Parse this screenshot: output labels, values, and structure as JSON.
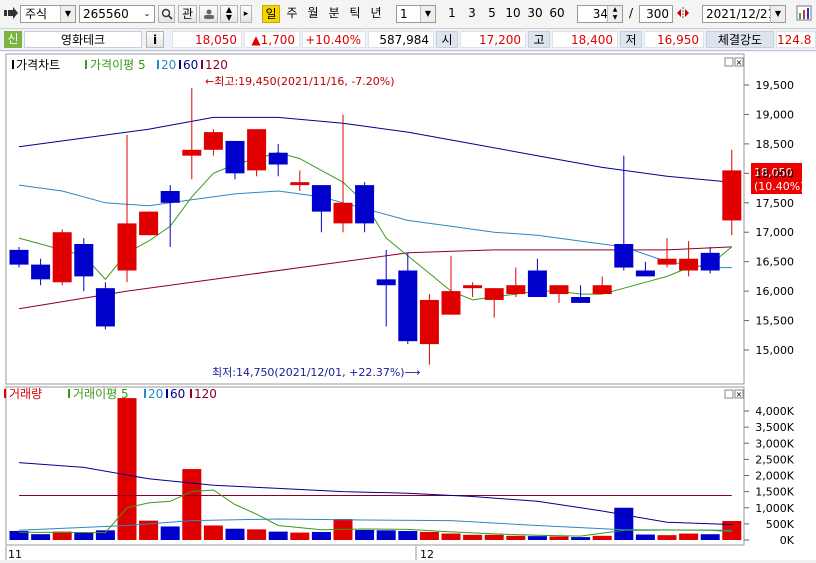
{
  "toolbar": {
    "market": "주식",
    "code": "265560",
    "btn_gwan": "관",
    "period_selected": "일",
    "periods": [
      "주",
      "월",
      "분",
      "틱",
      "년"
    ],
    "interval_value": "1",
    "interval_quick": [
      "1",
      "3",
      "5",
      "10",
      "30",
      "60"
    ],
    "zoom_value": "34",
    "zoom_sep": "/",
    "zoom_total": "300",
    "date": "2021/12/21"
  },
  "info": {
    "badge": "신",
    "name": "영화테크",
    "info_btn": "i",
    "price": "18,050",
    "change": "▲1,700",
    "change_pct": "+10.40%",
    "volume": "587,984",
    "open_label": "시",
    "open": "17,200",
    "high_label": "고",
    "high": "18,400",
    "low_label": "저",
    "low": "16,950",
    "strength_label": "체결강도",
    "strength": "124.8"
  },
  "price_legend": {
    "title": "가격차트",
    "ma_label": "가격이평",
    "ma": [
      "5",
      "20",
      "60",
      "120"
    ]
  },
  "vol_legend": {
    "title": "거래량",
    "ma_label": "거래이평",
    "ma": [
      "5",
      "20",
      "60",
      "120"
    ]
  },
  "annotations": {
    "high": "←최고:19,450(2021/11/16, -7.20%)",
    "low": "최저:14,750(2021/12/01, +22.37%)⟶"
  },
  "current_tag": {
    "price": "18,050",
    "pct": "(10.40%)"
  },
  "x_labels": [
    "11",
    "12"
  ],
  "colors": {
    "up": "#e00000",
    "down": "#0000cc",
    "ma5": "#3a9a1a",
    "ma20": "#2a88c8",
    "ma60": "#00008b",
    "ma120": "#8b0028"
  },
  "chart_data": {
    "type": "candlestick",
    "price_axis": {
      "ticks": [
        "15,000",
        "15,500",
        "16,000",
        "16,500",
        "17,000",
        "17,500",
        "18,000",
        "18,500",
        "19,000",
        "19,500"
      ],
      "range": [
        14600,
        19800
      ]
    },
    "volume_axis": {
      "ticks": [
        "0K",
        "500K",
        "1,000K",
        "1,500K",
        "2,000K",
        "2,500K",
        "3,000K",
        "3,500K",
        "4,000K"
      ],
      "range": [
        0,
        4300
      ]
    },
    "candles": [
      {
        "o": 16700,
        "h": 16750,
        "l": 16400,
        "c": 16450,
        "v": 280
      },
      {
        "o": 16450,
        "h": 16550,
        "l": 16100,
        "c": 16200,
        "v": 180
      },
      {
        "o": 16150,
        "h": 17050,
        "l": 16100,
        "c": 17000,
        "v": 260
      },
      {
        "o": 16800,
        "h": 16900,
        "l": 16000,
        "c": 16250,
        "v": 230
      },
      {
        "o": 16050,
        "h": 16150,
        "l": 15350,
        "c": 15400,
        "v": 300
      },
      {
        "o": 16350,
        "h": 18650,
        "l": 16150,
        "c": 17150,
        "v": 4400
      },
      {
        "o": 16950,
        "h": 17350,
        "l": 16950,
        "c": 17350,
        "v": 600
      },
      {
        "o": 17700,
        "h": 17800,
        "l": 16750,
        "c": 17500,
        "v": 420
      },
      {
        "o": 18300,
        "h": 19450,
        "l": 17900,
        "c": 18400,
        "v": 2200
      },
      {
        "o": 18400,
        "h": 18750,
        "l": 18300,
        "c": 18700,
        "v": 450
      },
      {
        "o": 18550,
        "h": 18550,
        "l": 17900,
        "c": 18000,
        "v": 350
      },
      {
        "o": 18050,
        "h": 18750,
        "l": 17950,
        "c": 18750,
        "v": 330
      },
      {
        "o": 18350,
        "h": 18500,
        "l": 17950,
        "c": 18150,
        "v": 260
      },
      {
        "o": 17800,
        "h": 18050,
        "l": 17700,
        "c": 17850,
        "v": 230
      },
      {
        "o": 17800,
        "h": 17800,
        "l": 17000,
        "c": 17350,
        "v": 250
      },
      {
        "o": 17150,
        "h": 19000,
        "l": 17000,
        "c": 17500,
        "v": 650
      },
      {
        "o": 17800,
        "h": 17850,
        "l": 17000,
        "c": 17150,
        "v": 310
      },
      {
        "o": 16200,
        "h": 16700,
        "l": 15400,
        "c": 16100,
        "v": 300
      },
      {
        "o": 16350,
        "h": 16650,
        "l": 15100,
        "c": 15150,
        "v": 280
      },
      {
        "o": 15100,
        "h": 15950,
        "l": 14750,
        "c": 15850,
        "v": 250
      },
      {
        "o": 15600,
        "h": 16600,
        "l": 15600,
        "c": 16000,
        "v": 200
      },
      {
        "o": 16050,
        "h": 16150,
        "l": 15900,
        "c": 16100,
        "v": 160
      },
      {
        "o": 15850,
        "h": 16050,
        "l": 15550,
        "c": 16050,
        "v": 160
      },
      {
        "o": 15950,
        "h": 16400,
        "l": 15900,
        "c": 16100,
        "v": 130
      },
      {
        "o": 16350,
        "h": 16550,
        "l": 15900,
        "c": 15900,
        "v": 120
      },
      {
        "o": 15950,
        "h": 16100,
        "l": 15800,
        "c": 16100,
        "v": 110
      },
      {
        "o": 15900,
        "h": 16100,
        "l": 15800,
        "c": 15800,
        "v": 90
      },
      {
        "o": 15950,
        "h": 16250,
        "l": 15950,
        "c": 16100,
        "v": 130
      },
      {
        "o": 16800,
        "h": 18300,
        "l": 16350,
        "c": 16400,
        "v": 1000
      },
      {
        "o": 16350,
        "h": 16500,
        "l": 16250,
        "c": 16250,
        "v": 170
      },
      {
        "o": 16450,
        "h": 16900,
        "l": 16400,
        "c": 16550,
        "v": 150
      },
      {
        "o": 16350,
        "h": 16850,
        "l": 16250,
        "c": 16550,
        "v": 200
      },
      {
        "o": 16650,
        "h": 16750,
        "l": 16300,
        "c": 16350,
        "v": 180
      },
      {
        "o": 17200,
        "h": 18400,
        "l": 16950,
        "c": 18050,
        "v": 590
      }
    ],
    "ma5": [
      {
        "i": 0,
        "v": 16900
      },
      {
        "i": 1,
        "v": 16800
      },
      {
        "i": 2,
        "v": 16700
      },
      {
        "i": 3,
        "v": 16600
      },
      {
        "i": 4,
        "v": 16200
      },
      {
        "i": 5,
        "v": 16650
      },
      {
        "i": 6,
        "v": 16850
      },
      {
        "i": 7,
        "v": 17100
      },
      {
        "i": 8,
        "v": 17600
      },
      {
        "i": 9,
        "v": 18000
      },
      {
        "i": 10,
        "v": 18150
      },
      {
        "i": 11,
        "v": 18250
      },
      {
        "i": 12,
        "v": 18350
      },
      {
        "i": 13,
        "v": 18250
      },
      {
        "i": 14,
        "v": 18050
      },
      {
        "i": 15,
        "v": 17850
      },
      {
        "i": 16,
        "v": 17500
      },
      {
        "i": 17,
        "v": 16900
      },
      {
        "i": 18,
        "v": 16600
      },
      {
        "i": 19,
        "v": 16300
      },
      {
        "i": 20,
        "v": 16000
      },
      {
        "i": 21,
        "v": 15850
      },
      {
        "i": 22,
        "v": 15900
      },
      {
        "i": 23,
        "v": 15950
      },
      {
        "i": 24,
        "v": 16000
      },
      {
        "i": 25,
        "v": 16000
      },
      {
        "i": 26,
        "v": 15950
      },
      {
        "i": 27,
        "v": 15950
      },
      {
        "i": 28,
        "v": 16050
      },
      {
        "i": 29,
        "v": 16150
      },
      {
        "i": 30,
        "v": 16250
      },
      {
        "i": 31,
        "v": 16400
      },
      {
        "i": 32,
        "v": 16450
      },
      {
        "i": 33,
        "v": 16750
      }
    ],
    "ma20": [
      {
        "i": 0,
        "v": 17800
      },
      {
        "i": 2,
        "v": 17700
      },
      {
        "i": 4,
        "v": 17500
      },
      {
        "i": 6,
        "v": 17450
      },
      {
        "i": 8,
        "v": 17550
      },
      {
        "i": 10,
        "v": 17650
      },
      {
        "i": 12,
        "v": 17700
      },
      {
        "i": 14,
        "v": 17600
      },
      {
        "i": 16,
        "v": 17400
      },
      {
        "i": 18,
        "v": 17200
      },
      {
        "i": 20,
        "v": 17100
      },
      {
        "i": 22,
        "v": 17000
      },
      {
        "i": 24,
        "v": 16950
      },
      {
        "i": 26,
        "v": 16850
      },
      {
        "i": 28,
        "v": 16750
      },
      {
        "i": 30,
        "v": 16500
      },
      {
        "i": 32,
        "v": 16400
      },
      {
        "i": 33,
        "v": 16400
      }
    ],
    "ma60": [
      {
        "i": 0,
        "v": 18450
      },
      {
        "i": 3,
        "v": 18600
      },
      {
        "i": 6,
        "v": 18750
      },
      {
        "i": 9,
        "v": 18950
      },
      {
        "i": 12,
        "v": 18950
      },
      {
        "i": 15,
        "v": 18850
      },
      {
        "i": 18,
        "v": 18700
      },
      {
        "i": 21,
        "v": 18500
      },
      {
        "i": 24,
        "v": 18300
      },
      {
        "i": 27,
        "v": 18100
      },
      {
        "i": 30,
        "v": 17950
      },
      {
        "i": 33,
        "v": 17850
      }
    ],
    "ma120": [
      {
        "i": 0,
        "v": 15700
      },
      {
        "i": 5,
        "v": 16000
      },
      {
        "i": 10,
        "v": 16250
      },
      {
        "i": 15,
        "v": 16500
      },
      {
        "i": 18,
        "v": 16650
      },
      {
        "i": 22,
        "v": 16700
      },
      {
        "i": 26,
        "v": 16700
      },
      {
        "i": 30,
        "v": 16700
      },
      {
        "i": 33,
        "v": 16750
      }
    ],
    "vma5": [
      {
        "i": 0,
        "v": 240
      },
      {
        "i": 4,
        "v": 230
      },
      {
        "i": 5,
        "v": 1000
      },
      {
        "i": 6,
        "v": 1150
      },
      {
        "i": 7,
        "v": 1200
      },
      {
        "i": 8,
        "v": 1500
      },
      {
        "i": 9,
        "v": 1550
      },
      {
        "i": 10,
        "v": 1100
      },
      {
        "i": 11,
        "v": 800
      },
      {
        "i": 12,
        "v": 450
      },
      {
        "i": 14,
        "v": 320
      },
      {
        "i": 16,
        "v": 340
      },
      {
        "i": 18,
        "v": 330
      },
      {
        "i": 20,
        "v": 250
      },
      {
        "i": 22,
        "v": 190
      },
      {
        "i": 24,
        "v": 150
      },
      {
        "i": 26,
        "v": 120
      },
      {
        "i": 28,
        "v": 300
      },
      {
        "i": 30,
        "v": 310
      },
      {
        "i": 32,
        "v": 300
      },
      {
        "i": 33,
        "v": 260
      }
    ],
    "vma20": [
      {
        "i": 0,
        "v": 300
      },
      {
        "i": 5,
        "v": 450
      },
      {
        "i": 8,
        "v": 600
      },
      {
        "i": 12,
        "v": 650
      },
      {
        "i": 16,
        "v": 620
      },
      {
        "i": 20,
        "v": 600
      },
      {
        "i": 24,
        "v": 450
      },
      {
        "i": 28,
        "v": 320
      },
      {
        "i": 33,
        "v": 300
      }
    ],
    "vma60": [
      {
        "i": 0,
        "v": 2400
      },
      {
        "i": 3,
        "v": 2250
      },
      {
        "i": 6,
        "v": 1900
      },
      {
        "i": 9,
        "v": 1700
      },
      {
        "i": 12,
        "v": 1600
      },
      {
        "i": 15,
        "v": 1500
      },
      {
        "i": 18,
        "v": 1450
      },
      {
        "i": 21,
        "v": 1350
      },
      {
        "i": 24,
        "v": 1200
      },
      {
        "i": 27,
        "v": 900
      },
      {
        "i": 30,
        "v": 550
      },
      {
        "i": 33,
        "v": 480
      }
    ],
    "vma120": [
      {
        "i": 0,
        "v": 1380
      },
      {
        "i": 33,
        "v": 1380
      }
    ]
  }
}
